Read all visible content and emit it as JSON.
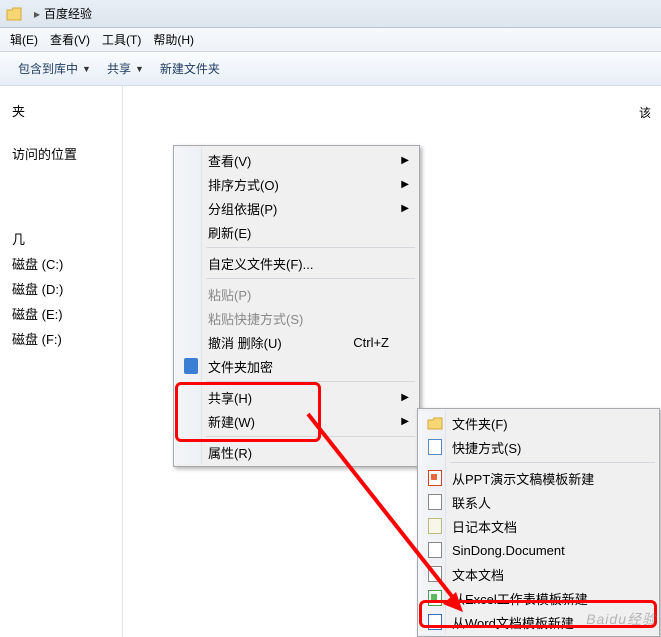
{
  "titlebar": {
    "location": "百度经验"
  },
  "menubar": {
    "edit": "辑(E)",
    "view": "查看(V)",
    "tools": "工具(T)",
    "help": "帮助(H)"
  },
  "toolbar": {
    "include": "包含到库中",
    "share": "共享",
    "newfolder": "新建文件夹"
  },
  "sidebar": {
    "quickaccess_header": "夹",
    "recent": "访问的位置",
    "thispc": "几",
    "drives": [
      "磁盘 (C:)",
      "磁盘 (D:)",
      "磁盘 (E:)",
      "磁盘 (F:)"
    ]
  },
  "content": {
    "text": "该"
  },
  "context_menu": {
    "view": "查看(V)",
    "sort": "排序方式(O)",
    "group": "分组依据(P)",
    "refresh": "刷新(E)",
    "customize": "自定义文件夹(F)...",
    "paste": "粘贴(P)",
    "paste_shortcut": "粘贴快捷方式(S)",
    "undo": "撤消 删除(U)",
    "undo_key": "Ctrl+Z",
    "encrypt": "文件夹加密",
    "share_h": "共享(H)",
    "new": "新建(W)",
    "properties": "属性(R)"
  },
  "new_menu": {
    "folder": "文件夹(F)",
    "shortcut": "快捷方式(S)",
    "ppt": "从PPT演示文稿模板新建",
    "contact": "联系人",
    "diary": "日记本文档",
    "sindong": "SinDong.Document",
    "textdoc": "文本文档",
    "excel": "从Excel工作表模板新建",
    "word": "从Word文档模板新建"
  },
  "watermark": "Baidu经验"
}
